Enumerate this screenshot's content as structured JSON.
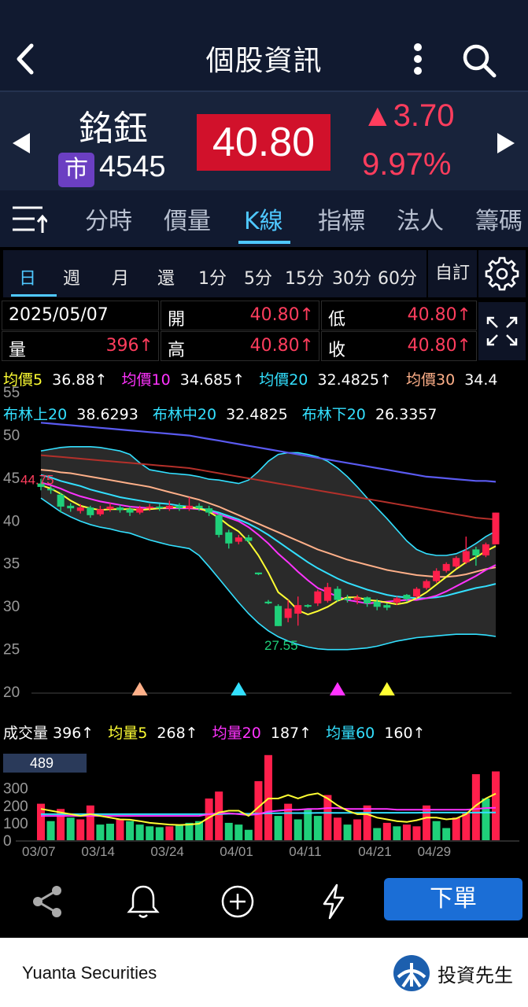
{
  "header": {
    "title": "個股資訊"
  },
  "stock": {
    "name": "銘鈺",
    "market_badge": "市",
    "code": "4545",
    "price": "40.80",
    "change": "▲3.70",
    "change_pct": "9.97%",
    "up_color": "#ff3d5d"
  },
  "tabs": [
    "分時",
    "價量",
    "K線",
    "指標",
    "法人",
    "籌碼"
  ],
  "active_tab": "K線",
  "periods": [
    "日",
    "週",
    "月",
    "還",
    "1分",
    "5分",
    "15分",
    "30分",
    "60分"
  ],
  "custom_label": "自訂",
  "ohlc": {
    "date": "2025/05/07",
    "open_label": "開",
    "open": "40.80↑",
    "low_label": "低",
    "low": "40.80↑",
    "vol_label": "量",
    "vol": "396↑",
    "high_label": "高",
    "high": "40.80↑",
    "close_label": "收",
    "close": "40.80↑"
  },
  "ma_legend": [
    {
      "label": "均價5",
      "value": "36.88↑",
      "color": "#ffff33"
    },
    {
      "label": "均價10",
      "value": "34.685↑",
      "color": "#ff33ff"
    },
    {
      "label": "均價20",
      "value": "32.4825↑",
      "color": "#33e0ff"
    },
    {
      "label": "均價30",
      "value": "34.4",
      "color": "#ffb089"
    }
  ],
  "boll_legend": [
    {
      "label": "布林上20",
      "value": "38.6293"
    },
    {
      "label": "布林中20",
      "value": "32.4825"
    },
    {
      "label": "布林下20",
      "value": "26.3357"
    }
  ],
  "vol_legend": [
    {
      "label": "成交量",
      "value": "396↑",
      "color": "#ffffff"
    },
    {
      "label": "均量5",
      "value": "268↑",
      "color": "#ffff33"
    },
    {
      "label": "均量20",
      "value": "187↑",
      "color": "#ff33ff"
    },
    {
      "label": "均量60",
      "value": "160↑",
      "color": "#33e0ff"
    }
  ],
  "chart_data": [
    {
      "type": "candlestick",
      "y_ticks": [
        55,
        50,
        45,
        40,
        35,
        30,
        25,
        20
      ],
      "ylim": [
        20,
        55
      ],
      "annotations": [
        "44.75",
        "27.55"
      ],
      "candles": [
        {
          "o": 44.2,
          "c": 43.8,
          "h": 44.75,
          "l": 43.4
        },
        {
          "o": 43.6,
          "c": 43.4,
          "h": 43.9,
          "l": 43.0
        },
        {
          "o": 42.9,
          "c": 41.5,
          "h": 43.1,
          "l": 40.8
        },
        {
          "o": 41.6,
          "c": 41.3,
          "h": 41.9,
          "l": 40.9
        },
        {
          "o": 41.0,
          "c": 41.4,
          "h": 41.8,
          "l": 40.7
        },
        {
          "o": 41.4,
          "c": 40.5,
          "h": 41.6,
          "l": 40.2
        },
        {
          "o": 40.6,
          "c": 41.2,
          "h": 41.6,
          "l": 40.4
        },
        {
          "o": 41.2,
          "c": 41.5,
          "h": 41.9,
          "l": 40.9
        },
        {
          "o": 41.4,
          "c": 41.1,
          "h": 41.7,
          "l": 40.8
        },
        {
          "o": 41.2,
          "c": 40.8,
          "h": 41.5,
          "l": 40.4
        },
        {
          "o": 40.8,
          "c": 41.3,
          "h": 41.6,
          "l": 40.6
        },
        {
          "o": 41.3,
          "c": 41.5,
          "h": 41.8,
          "l": 41.0
        },
        {
          "o": 41.5,
          "c": 41.3,
          "h": 41.8,
          "l": 41.0
        },
        {
          "o": 41.3,
          "c": 41.6,
          "h": 42.2,
          "l": 41.0
        },
        {
          "o": 41.6,
          "c": 41.3,
          "h": 41.9,
          "l": 41.0
        },
        {
          "o": 41.3,
          "c": 41.6,
          "h": 42.6,
          "l": 41.0
        },
        {
          "o": 41.6,
          "c": 41.3,
          "h": 41.9,
          "l": 41.0
        },
        {
          "o": 41.3,
          "c": 40.8,
          "h": 41.6,
          "l": 40.4
        },
        {
          "o": 40.5,
          "c": 38.2,
          "h": 40.7,
          "l": 37.9
        },
        {
          "o": 38.5,
          "c": 37.2,
          "h": 38.8,
          "l": 36.6
        },
        {
          "o": 37.4,
          "c": 37.9,
          "h": 38.2,
          "l": 37.1
        },
        {
          "o": 37.9,
          "c": 37.5,
          "h": 38.2,
          "l": 37.2
        },
        {
          "o": 33.8,
          "c": 33.6,
          "h": 33.8,
          "l": 33.5
        },
        {
          "o": 30.4,
          "c": 30.2,
          "h": 30.6,
          "l": 30.1
        },
        {
          "o": 29.9,
          "c": 27.55,
          "h": 30.1,
          "l": 27.55
        },
        {
          "o": 28.5,
          "c": 29.6,
          "h": 30.6,
          "l": 28.0
        },
        {
          "o": 29.0,
          "c": 30.0,
          "h": 31.0,
          "l": 27.6
        },
        {
          "o": 30.0,
          "c": 29.9,
          "h": 30.1,
          "l": 29.7
        },
        {
          "o": 30.2,
          "c": 31.6,
          "h": 31.8,
          "l": 29.9
        },
        {
          "o": 30.5,
          "c": 32.1,
          "h": 32.6,
          "l": 30.3
        },
        {
          "o": 31.9,
          "c": 30.6,
          "h": 32.2,
          "l": 30.4
        },
        {
          "o": 30.8,
          "c": 30.6,
          "h": 31.2,
          "l": 30.3
        },
        {
          "o": 30.6,
          "c": 30.9,
          "h": 31.2,
          "l": 30.1
        },
        {
          "o": 30.9,
          "c": 30.2,
          "h": 31.0,
          "l": 29.8
        },
        {
          "o": 30.4,
          "c": 29.8,
          "h": 30.7,
          "l": 29.4
        },
        {
          "o": 30.0,
          "c": 29.7,
          "h": 30.2,
          "l": 29.4
        },
        {
          "o": 30.3,
          "c": 30.8,
          "h": 31.0,
          "l": 30.0
        },
        {
          "o": 31.2,
          "c": 30.7,
          "h": 31.3,
          "l": 30.4
        },
        {
          "o": 31.0,
          "c": 31.9,
          "h": 32.1,
          "l": 30.8
        },
        {
          "o": 32.0,
          "c": 32.8,
          "h": 33.0,
          "l": 31.8
        },
        {
          "o": 32.8,
          "c": 34.0,
          "h": 34.3,
          "l": 32.6
        },
        {
          "o": 34.0,
          "c": 34.8,
          "h": 35.0,
          "l": 33.8
        },
        {
          "o": 34.5,
          "c": 35.5,
          "h": 35.7,
          "l": 34.3
        },
        {
          "o": 35.0,
          "c": 36.3,
          "h": 38.0,
          "l": 34.8
        },
        {
          "o": 36.5,
          "c": 35.8,
          "h": 36.8,
          "l": 34.6
        },
        {
          "o": 35.8,
          "c": 37.1,
          "h": 37.3,
          "l": 35.6
        },
        {
          "o": 37.1,
          "c": 40.8,
          "h": 40.8,
          "l": 37.1
        }
      ],
      "ma5": [
        44.0,
        43.6,
        43.0,
        42.2,
        41.6,
        41.3,
        41.1,
        41.2,
        41.2,
        41.2,
        41.1,
        41.2,
        41.3,
        41.4,
        41.4,
        41.4,
        41.3,
        40.9,
        40.2,
        39.3,
        38.6,
        37.4,
        35.8,
        33.8,
        31.5,
        30.6,
        29.4,
        28.9,
        29.3,
        29.8,
        30.5,
        30.9,
        30.9,
        30.6,
        30.5,
        30.3,
        30.1,
        30.3,
        30.8,
        31.5,
        32.4,
        33.3,
        34.2,
        35.0,
        35.6,
        36.3,
        36.88
      ],
      "ma10": [
        44.3,
        44.0,
        43.6,
        43.1,
        42.7,
        42.4,
        42.1,
        41.9,
        41.7,
        41.5,
        41.4,
        41.3,
        41.3,
        41.3,
        41.3,
        41.3,
        41.2,
        41.0,
        40.6,
        40.2,
        39.8,
        39.1,
        38.2,
        37.2,
        36.0,
        35.0,
        33.9,
        32.9,
        32.0,
        31.5,
        31.0,
        30.6,
        30.4,
        30.2,
        30.3,
        30.4,
        30.5,
        30.6,
        30.6,
        30.8,
        31.1,
        31.6,
        32.2,
        32.8,
        33.4,
        34.1,
        34.685
      ],
      "ma20": [
        45.2,
        44.9,
        44.5,
        44.2,
        43.9,
        43.5,
        43.2,
        42.9,
        42.6,
        42.4,
        42.2,
        42.0,
        41.9,
        41.8,
        41.6,
        41.5,
        41.3,
        41.1,
        40.8,
        40.4,
        40.0,
        39.5,
        38.9,
        38.2,
        37.4,
        36.6,
        35.8,
        35.0,
        34.3,
        33.7,
        33.1,
        32.6,
        32.2,
        31.8,
        31.5,
        31.2,
        31.0,
        30.9,
        30.8,
        30.8,
        30.9,
        31.1,
        31.4,
        31.7,
        32.0,
        32.2,
        32.4825
      ],
      "ma30": [
        45.8,
        45.7,
        45.5,
        45.4,
        45.2,
        45.0,
        44.8,
        44.6,
        44.4,
        44.2,
        44.0,
        43.8,
        43.5,
        43.2,
        42.9,
        42.6,
        42.3,
        41.9,
        41.5,
        41.0,
        40.5,
        40.0,
        39.5,
        39.0,
        38.5,
        38.0,
        37.5,
        37.0,
        36.5,
        36.1,
        35.7,
        35.3,
        35.0,
        34.7,
        34.4,
        34.1,
        33.9,
        33.7,
        33.5,
        33.4,
        33.3,
        33.3,
        33.4,
        33.6,
        33.9,
        34.2,
        34.4
      ],
      "ma60": [
        47.5,
        47.4,
        47.3,
        47.2,
        47.1,
        47.0,
        46.9,
        46.8,
        46.7,
        46.6,
        46.5,
        46.4,
        46.3,
        46.2,
        46.1,
        46.0,
        45.8,
        45.6,
        45.4,
        45.2,
        45.0,
        44.8,
        44.6,
        44.4,
        44.2,
        44.0,
        43.8,
        43.6,
        43.4,
        43.2,
        43.0,
        42.8,
        42.6,
        42.4,
        42.2,
        42.0,
        41.8,
        41.6,
        41.4,
        41.2,
        41.0,
        40.8,
        40.6,
        40.4,
        40.2,
        40.1,
        40.0
      ],
      "ma120": [
        51.3,
        51.2,
        51.1,
        51.0,
        50.9,
        50.8,
        50.7,
        50.6,
        50.5,
        50.4,
        50.3,
        50.2,
        50.1,
        50.0,
        49.9,
        49.8,
        49.6,
        49.4,
        49.2,
        49.0,
        48.8,
        48.6,
        48.4,
        48.2,
        48.0,
        47.8,
        47.6,
        47.4,
        47.2,
        47.0,
        46.8,
        46.6,
        46.4,
        46.2,
        46.0,
        45.8,
        45.6,
        45.4,
        45.2,
        45.0,
        44.9,
        44.8,
        44.7,
        44.6,
        44.5,
        44.5,
        44.4
      ],
      "boll_upper": [
        48.0,
        48.2,
        48.4,
        48.5,
        48.5,
        48.5,
        48.4,
        48.2,
        48.0,
        47.6,
        46.6,
        45.8,
        45.6,
        45.4,
        45.3,
        45.2,
        45.0,
        44.7,
        44.6,
        44.4,
        44.2,
        44.6,
        45.6,
        46.8,
        47.6,
        47.8,
        47.8,
        47.6,
        47.3,
        46.8,
        46.0,
        45.0,
        43.8,
        42.5,
        41.3,
        40.1,
        38.8,
        37.5,
        36.5,
        36.0,
        35.8,
        35.8,
        36.0,
        36.5,
        37.2,
        38.0,
        38.6293
      ],
      "boll_lower": [
        42.5,
        41.7,
        40.9,
        40.3,
        39.8,
        39.4,
        39.1,
        38.9,
        38.6,
        38.4,
        38.0,
        37.6,
        37.3,
        37.0,
        36.8,
        36.6,
        35.8,
        34.5,
        33.1,
        31.7,
        30.3,
        29.0,
        27.9,
        27.0,
        26.3,
        25.8,
        25.4,
        25.1,
        24.9,
        24.8,
        24.8,
        24.8,
        24.9,
        25.0,
        25.2,
        25.5,
        25.8,
        26.0,
        26.2,
        26.3,
        26.4,
        26.5,
        26.6,
        26.6,
        26.6,
        26.5,
        26.3357
      ],
      "signals": [
        {
          "i": 10,
          "color": "#ffb089"
        },
        {
          "i": 20,
          "color": "#33e0ff"
        },
        {
          "i": 30,
          "color": "#ff33ff"
        },
        {
          "i": 35,
          "color": "#ffff33"
        }
      ]
    },
    {
      "type": "bar",
      "y_ticks": [
        300,
        200,
        100,
        0
      ],
      "ymax": 489,
      "max_label": "489",
      "x_labels": [
        "03/07",
        "03/14",
        "03/24",
        "04/01",
        "04/11",
        "04/21",
        "04/29"
      ],
      "volume": [
        210,
        110,
        180,
        130,
        120,
        200,
        90,
        95,
        120,
        110,
        90,
        80,
        75,
        80,
        90,
        100,
        110,
        240,
        280,
        100,
        90,
        60,
        340,
        490,
        140,
        210,
        120,
        180,
        140,
        260,
        130,
        90,
        120,
        200,
        70,
        100,
        80,
        90,
        80,
        200,
        110,
        70,
        130,
        160,
        380,
        240,
        396
      ],
      "vol_up": [
        1,
        0,
        1,
        0,
        1,
        1,
        0,
        0,
        1,
        0,
        0,
        0,
        0,
        1,
        0,
        0,
        0,
        1,
        1,
        0,
        0,
        0,
        1,
        1,
        0,
        1,
        0,
        0,
        0,
        1,
        1,
        0,
        1,
        1,
        0,
        1,
        0,
        1,
        1,
        1,
        0,
        0,
        1,
        1,
        1,
        0,
        1
      ],
      "vol_ma5": [
        180,
        170,
        160,
        150,
        140,
        150,
        140,
        130,
        120,
        118,
        110,
        100,
        95,
        90,
        88,
        90,
        95,
        130,
        160,
        170,
        170,
        140,
        190,
        240,
        240,
        260,
        240,
        260,
        270,
        240,
        200,
        170,
        150,
        150,
        130,
        120,
        110,
        105,
        115,
        130,
        130,
        120,
        125,
        150,
        200,
        240,
        268
      ],
      "vol_ma20": [
        140,
        140,
        140,
        140,
        140,
        140,
        140,
        140,
        140,
        140,
        140,
        140,
        140,
        140,
        140,
        140,
        140,
        150,
        155,
        155,
        150,
        145,
        150,
        165,
        170,
        175,
        175,
        180,
        180,
        185,
        185,
        180,
        180,
        180,
        180,
        180,
        175,
        175,
        175,
        175,
        175,
        175,
        175,
        175,
        180,
        185,
        187
      ],
      "vol_ma60": [
        150,
        150,
        150,
        150,
        150,
        150,
        150,
        150,
        150,
        150,
        150,
        150,
        150,
        150,
        150,
        150,
        150,
        150,
        150,
        152,
        152,
        152,
        153,
        155,
        155,
        156,
        156,
        156,
        157,
        157,
        157,
        157,
        157,
        158,
        158,
        158,
        158,
        158,
        158,
        159,
        159,
        159,
        159,
        159,
        159,
        160,
        160
      ]
    }
  ],
  "bottom": {
    "order_label": "下單"
  },
  "footer": {
    "brand": "Yuanta Securities",
    "app_name": "投資先生"
  }
}
